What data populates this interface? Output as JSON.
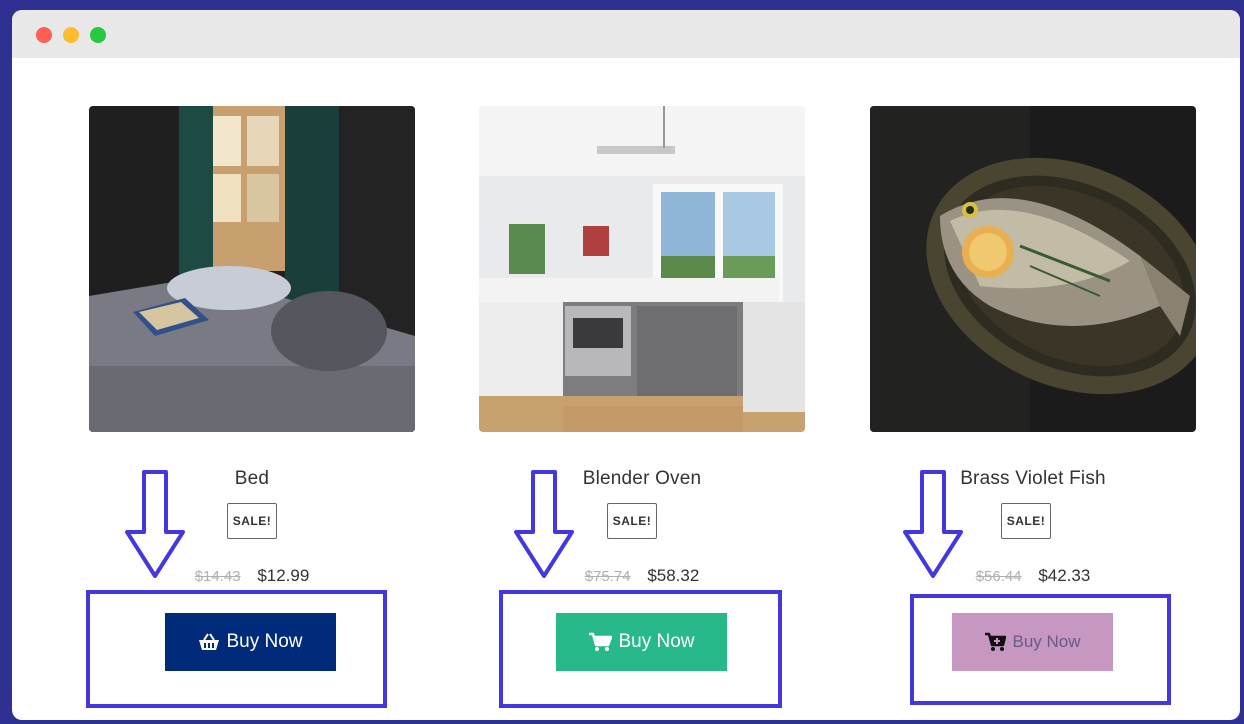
{
  "window": {
    "controls": [
      "close",
      "minimize",
      "maximize"
    ]
  },
  "products": [
    {
      "name": "Bed",
      "badge": "SALE!",
      "old_price": "$14.43",
      "new_price": "$12.99",
      "button_label": "Buy Now",
      "button_icon": "basket-icon",
      "button_color": "#002a7a",
      "button_text_color": "#ffffff"
    },
    {
      "name": "Blender Oven",
      "badge": "SALE!",
      "old_price": "$75.74",
      "new_price": "$58.32",
      "button_label": "Buy Now",
      "button_icon": "cart-icon",
      "button_color": "#27b98a",
      "button_text_color": "#ffffff"
    },
    {
      "name": "Brass Violet Fish",
      "badge": "SALE!",
      "old_price": "$56.44",
      "new_price": "$42.33",
      "button_label": "Buy Now",
      "button_icon": "cart-plus-icon",
      "button_color": "#c597c1",
      "button_text_color": "#6a5a8a"
    }
  ],
  "annotation_color": "#4338e0",
  "border_color": "#2e3192"
}
